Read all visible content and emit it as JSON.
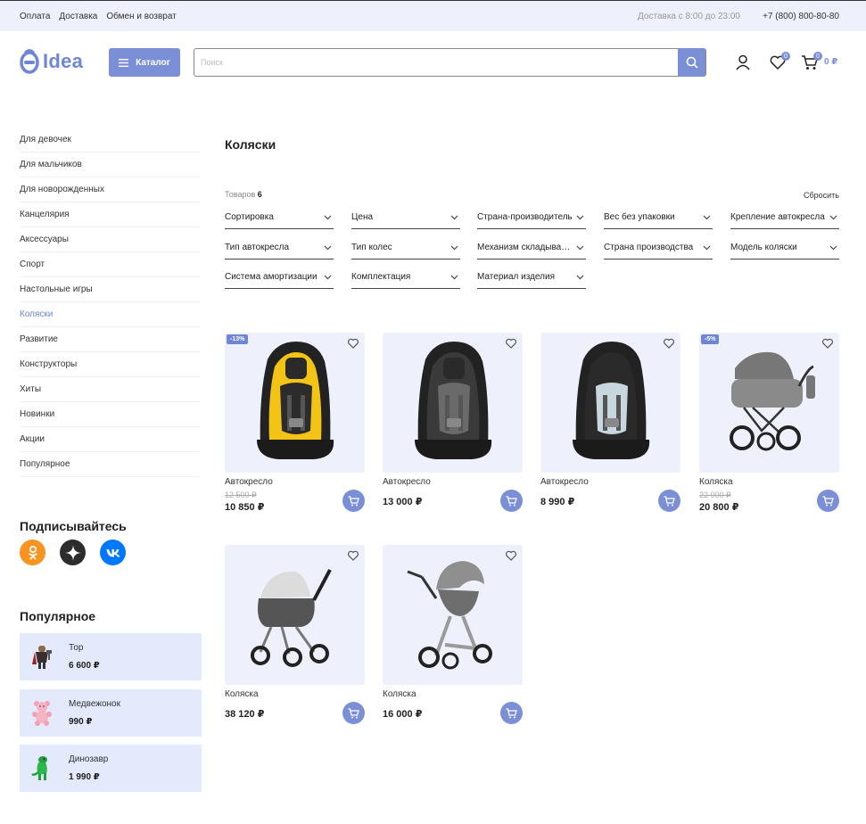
{
  "topbar": {
    "links": [
      "Оплата",
      "Доставка",
      "Обмен и возврат"
    ],
    "hours": "Доставка с 8:00 до 23:00",
    "phone": "+7 (800) 800-80-80"
  },
  "header": {
    "logo_text": "Idea",
    "catalog_label": "Каталог",
    "search_placeholder": "Поиск",
    "favorites_count": "0",
    "cart_count": "0",
    "cart_sum": "0 ₽"
  },
  "sidebar": {
    "items": [
      {
        "label": "Для девочек",
        "active": false
      },
      {
        "label": "Для мальчиков",
        "active": false
      },
      {
        "label": "Для новорожденных",
        "active": false
      },
      {
        "label": "Канцелярия",
        "active": false
      },
      {
        "label": "Аксессуары",
        "active": false
      },
      {
        "label": "Спорт",
        "active": false
      },
      {
        "label": "Настольные игры",
        "active": false
      },
      {
        "label": "Коляски",
        "active": true
      },
      {
        "label": "Развитие",
        "active": false
      },
      {
        "label": "Конструкторы",
        "active": false
      },
      {
        "label": "Хиты",
        "active": false
      },
      {
        "label": "Новинки",
        "active": false
      },
      {
        "label": "Акции",
        "active": false
      },
      {
        "label": "Популярное",
        "active": false
      }
    ],
    "subscribe_title": "Подписывайтесь",
    "socials": [
      "odnoklassniki-icon",
      "dzen-icon",
      "vk-icon"
    ],
    "popular_title": "Популярное",
    "popular": [
      {
        "name": "Тор",
        "price": "6 600 ₽"
      },
      {
        "name": "Медвежонок",
        "price": "990 ₽"
      },
      {
        "name": "Динозавр",
        "price": "1 990 ₽"
      }
    ]
  },
  "main": {
    "title": "Коляски",
    "count_label": "Товаров",
    "count_value": "6",
    "reset_label": "Сбросить",
    "filters": [
      "Сортировка",
      "Цена",
      "Страна-производитель",
      "Вес без упаковки",
      "Крепление автокресла",
      "Тип автокресла",
      "Тип колес",
      "Механизм складывания",
      "Страна производства",
      "Модель коляски",
      "Система амортизации",
      "Комплектация",
      "Материал изделия"
    ],
    "products": [
      {
        "name": "Автокресло",
        "old_price": "12 500 ₽",
        "price": "10 850 ₽",
        "discount": "-13%"
      },
      {
        "name": "Автокресло",
        "old_price": "",
        "price": "13 000 ₽",
        "discount": ""
      },
      {
        "name": "Автокресло",
        "old_price": "",
        "price": "8 990 ₽",
        "discount": ""
      },
      {
        "name": "Коляска",
        "old_price": "22 000 ₽",
        "price": "20 800 ₽",
        "discount": "-5%"
      },
      {
        "name": "Коляска",
        "old_price": "",
        "price": "38 120 ₽",
        "discount": ""
      },
      {
        "name": "Коляска",
        "old_price": "",
        "price": "16 000 ₽",
        "discount": ""
      }
    ]
  },
  "colors": {
    "accent": "#7b8fd7",
    "topbar_bg": "#eef0fc",
    "card_bg": "#eef1fc",
    "popular_bg": "#e4e9fb"
  }
}
